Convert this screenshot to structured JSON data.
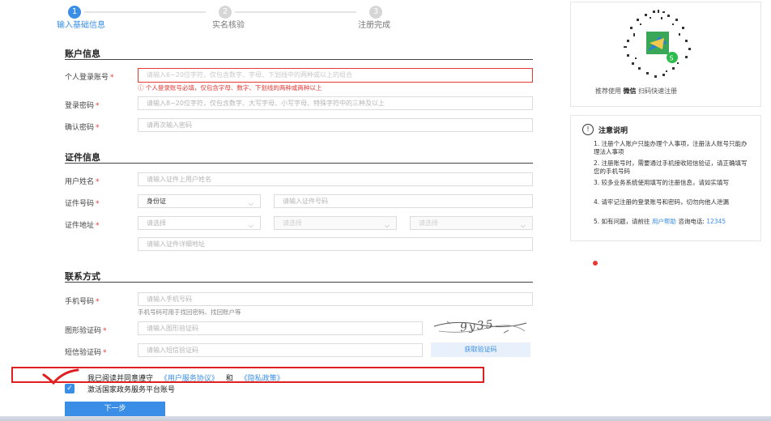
{
  "steps": [
    {
      "num": "1",
      "label": "输入基础信息"
    },
    {
      "num": "2",
      "label": "实名核验"
    },
    {
      "num": "3",
      "label": "注册完成"
    }
  ],
  "account_section": {
    "title": "账户信息",
    "username_label": "个人登录账号",
    "username_placeholder": "请输入6~20位字符，仅包含数字、字母、下划线中的两种或以上的组合",
    "username_error": "ⓘ 个人登录账号必填，仅包含字母、数字、下划线的两种或两种以上",
    "password_label": "登录密码",
    "password_placeholder": "请输入8~20位字符，仅包含数字、大写字母、小写字母、特殊字符中的三种及以上",
    "confirm_label": "确认密码",
    "confirm_placeholder": "请再次输入密码"
  },
  "id_section": {
    "title": "证件信息",
    "name_label": "用户姓名",
    "name_placeholder": "请输入证件上用户姓名",
    "id_type_label": "证件号码",
    "id_type_value": "身份证",
    "id_number_placeholder": "请输入证件号码",
    "address_label": "证件地址",
    "select_placeholder": "请选择",
    "address_detail_placeholder": "请输入证件详细地址"
  },
  "contact_section": {
    "title": "联系方式",
    "phone_label": "手机号码",
    "phone_placeholder": "请输入手机号码",
    "phone_hint": "手机号码可用于找回密码、找回账户等",
    "captcha_label": "图形验证码",
    "captcha_placeholder": "请输入图形验证码",
    "captcha_text": "9y35",
    "sms_label": "短信验证码",
    "sms_placeholder": "请输入短信验证码",
    "sms_button": "获取验证码"
  },
  "agreement": {
    "prefix": "我已阅读并同意遵守",
    "terms": "《用户服务协议》",
    "and": "和",
    "privacy": "《隐私政策》",
    "activate": "激活国家政务服务平台账号"
  },
  "next_button": "下一步",
  "qr_panel": {
    "prefix": "推荐使用",
    "app": "微信",
    "suffix": "扫码快速注册"
  },
  "notice": {
    "title": "注意说明",
    "items": [
      "1. 注册个人账户只能办理个人事项，注册法人账号只能办理法人事项",
      "2. 注册账号时，需要通过手机接收短信验证，请正确填写您的手机号码",
      "3. 较多业务系统使用填写的注册信息，请如实填写",
      "4. 请牢记注册的登录账号和密码，切勿向他人泄漏"
    ],
    "item5_prefix": "5. 如有问题，请前往",
    "item5_link": "用户帮助",
    "item5_mid": "咨询电话:",
    "item5_phone": "12345"
  },
  "colors": {
    "accent": "#3a8ee6",
    "error": "#e53935"
  }
}
